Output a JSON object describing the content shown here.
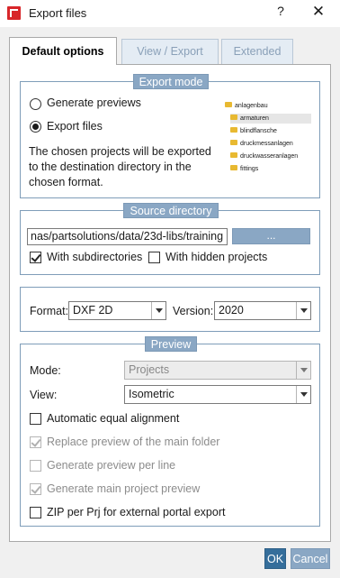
{
  "window": {
    "title": "Export files",
    "help_label": "?",
    "close_label": "✕"
  },
  "tabs": [
    {
      "label": "Default options"
    },
    {
      "label": "View / Export"
    },
    {
      "label": "Extended"
    }
  ],
  "export_mode": {
    "title": "Export mode",
    "options": [
      {
        "label": "Generate previews",
        "selected": false
      },
      {
        "label": "Export files",
        "selected": true
      }
    ],
    "description": "The chosen projects will be exported to the destination directory in the chosen format.",
    "preview_tree": [
      "anlagenbau",
      "armaturen",
      "blindflansche",
      "druckmessanlagen",
      "druckwasseranlagen",
      "fittings"
    ]
  },
  "source_directory": {
    "title": "Source directory",
    "path": "nas/partsolutions/data/23d-libs/training",
    "browse_label": "...",
    "with_subdirectories": {
      "label": "With subdirectories",
      "checked": true
    },
    "with_hidden_projects": {
      "label": "With hidden projects",
      "checked": false
    }
  },
  "format_row": {
    "format_label": "Format:",
    "format_value": "DXF 2D",
    "version_label": "Version:",
    "version_value": "2020"
  },
  "preview": {
    "title": "Preview",
    "mode_label": "Mode:",
    "mode_value": "Projects",
    "view_label": "View:",
    "view_value": "Isometric",
    "options": [
      {
        "label": "Automatic equal alignment",
        "checked": false,
        "enabled": true
      },
      {
        "label": "Replace preview of the main folder",
        "checked": true,
        "enabled": false
      },
      {
        "label": "Generate preview per line",
        "checked": false,
        "enabled": false
      },
      {
        "label": "Generate main project preview",
        "checked": true,
        "enabled": false
      },
      {
        "label": "ZIP per Prj for external portal export",
        "checked": false,
        "enabled": true
      }
    ]
  },
  "buttons": {
    "ok": "OK",
    "cancel": "Cancel"
  }
}
